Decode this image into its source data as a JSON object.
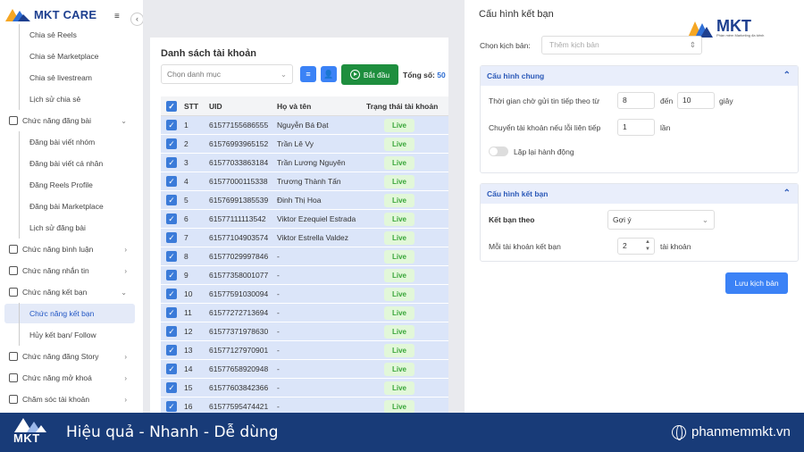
{
  "app": {
    "logo": "MKT CARE"
  },
  "sidebar": {
    "items": [
      {
        "label": "Chia sẻ Reels",
        "type": "sub"
      },
      {
        "label": "Chia sẻ Marketplace",
        "type": "sub"
      },
      {
        "label": "Chia sẻ livestream",
        "type": "sub"
      },
      {
        "label": "Lịch sử chia sẻ",
        "type": "sub"
      },
      {
        "label": "Chức năng đăng bài",
        "type": "group"
      },
      {
        "label": "Đăng bài viết nhóm",
        "type": "sub"
      },
      {
        "label": "Đăng bài viết cá nhân",
        "type": "sub"
      },
      {
        "label": "Đăng Reels Profile",
        "type": "sub"
      },
      {
        "label": "Đăng bài Marketplace",
        "type": "sub"
      },
      {
        "label": "Lịch sử đăng bài",
        "type": "sub"
      },
      {
        "label": "Chức năng bình luận",
        "type": "group"
      },
      {
        "label": "Chức năng nhắn tin",
        "type": "group"
      },
      {
        "label": "Chức năng kết bạn",
        "type": "group"
      },
      {
        "label": "Chức năng kết bạn",
        "type": "active"
      },
      {
        "label": "Hủy kết bạn/ Follow",
        "type": "sub"
      },
      {
        "label": "Chức năng đăng Story",
        "type": "group"
      },
      {
        "label": "Chức năng mở khoá",
        "type": "group"
      },
      {
        "label": "Chăm sóc tài khoản",
        "type": "group"
      }
    ]
  },
  "accounts": {
    "title": "Danh sách tài khoản",
    "category_placeholder": "Chọn danh mục",
    "start_label": "Bắt đầu",
    "total_label": "Tổng số:",
    "total_value": "50",
    "columns": [
      "STT",
      "UID",
      "Họ và tên",
      "Trạng thái tài khoản"
    ],
    "rows": [
      [
        "1",
        "61577155686555",
        "Nguyễn Bá Đạt",
        "Live"
      ],
      [
        "2",
        "61576993965152",
        "Trần Lê Vy",
        "Live"
      ],
      [
        "3",
        "61577033863184",
        "Trần Lương Nguyên",
        "Live"
      ],
      [
        "4",
        "61577000115338",
        "Trương Thành Tấn",
        "Live"
      ],
      [
        "5",
        "61576991385539",
        "Đinh Thị Hoa",
        "Live"
      ],
      [
        "6",
        "61577111113542",
        "Viktor Ezequiel Estrada",
        "Live"
      ],
      [
        "7",
        "61577104903574",
        "Viktor Estrella Valdez",
        "Live"
      ],
      [
        "8",
        "61577029997846",
        "-",
        "Live"
      ],
      [
        "9",
        "61577358001077",
        "-",
        "Live"
      ],
      [
        "10",
        "61577591030094",
        "-",
        "Live"
      ],
      [
        "11",
        "61577272713694",
        "-",
        "Live"
      ],
      [
        "12",
        "61577371978630",
        "-",
        "Live"
      ],
      [
        "13",
        "61577127970901",
        "-",
        "Live"
      ],
      [
        "14",
        "61577658920948",
        "-",
        "Live"
      ],
      [
        "15",
        "61577603842366",
        "-",
        "Live"
      ],
      [
        "16",
        "61577595474421",
        "-",
        "Live"
      ]
    ]
  },
  "config": {
    "title": "Cấu hình kết bạn",
    "script_label": "Chọn kịch bản:",
    "script_placeholder": "Thêm kịch bản",
    "general": {
      "title": "Cấu hình chung",
      "wait_label": "Thời gian chờ gửi tin tiếp theo từ",
      "wait_from": "8",
      "to_label": "đến",
      "wait_to": "10",
      "unit_sec": "giây",
      "switch_label": "Chuyển tài khoản nếu lỗi liên tiếp",
      "switch_value": "1",
      "unit_times": "lần",
      "repeat_label": "Lặp lại hành động"
    },
    "friend": {
      "title": "Cấu hình kết bạn",
      "by_label": "Kết bạn theo",
      "by_value": "Gợi ý",
      "per_label": "Mỗi tài khoản kết bạn",
      "per_value": "2",
      "unit_acc": "tài khoản"
    },
    "save_label": "Lưu kịch bản"
  },
  "brand": {
    "mkt": "MKT",
    "tagline": "Phần mềm Marketing đa kênh"
  },
  "banner": {
    "logo": "MKT",
    "slogan": "Hiệu quả - Nhanh  - Dễ dùng",
    "site": "phanmemmkt.vn"
  },
  "colors": {
    "primary": "#3b82f6",
    "start": "#1e8e3e",
    "banner": "#183b78",
    "row": "#dbe5f9"
  }
}
